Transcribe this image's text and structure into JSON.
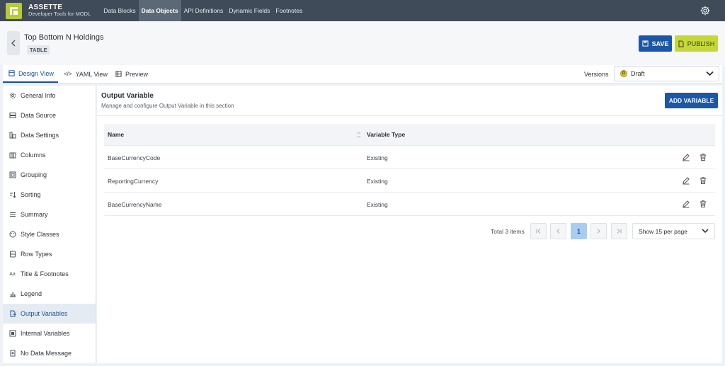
{
  "app": {
    "brand_name": "ASSETTE",
    "brand_sub": "Developer Tools for MODL",
    "nav": [
      "Data Blocks",
      "Data Objects",
      "API Definitions",
      "Dynamic Fields",
      "Footnotes"
    ],
    "active_nav": "Data Objects",
    "accent": "#1c56a6",
    "publish_color": "#c4d83a",
    "topbar_color": "#3f4b58"
  },
  "header": {
    "title": "Top Bottom N Holdings",
    "badge": "TABLE",
    "save_label": "SAVE",
    "publish_label": "PUBLISH"
  },
  "view_tabs": {
    "design": "Design View",
    "yaml": "YAML View",
    "preview": "Preview"
  },
  "versions": {
    "label": "Versions",
    "selected": "Draft",
    "badge_letter": "D"
  },
  "sidebar": {
    "items": [
      {
        "label": "General Info",
        "icon": "gear-icon"
      },
      {
        "label": "Data Source",
        "icon": "database-icon"
      },
      {
        "label": "Data Settings",
        "icon": "data-settings-icon"
      },
      {
        "label": "Columns",
        "icon": "columns-icon"
      },
      {
        "label": "Grouping",
        "icon": "grouping-icon"
      },
      {
        "label": "Sorting",
        "icon": "sort-icon"
      },
      {
        "label": "Summary",
        "icon": "summary-icon"
      },
      {
        "label": "Style Classes",
        "icon": "palette-icon"
      },
      {
        "label": "Row Types",
        "icon": "row-types-icon"
      },
      {
        "label": "Title & Footnotes",
        "icon": "text-icon"
      },
      {
        "label": "Legend",
        "icon": "legend-icon"
      },
      {
        "label": "Output Variables",
        "icon": "output-variable-icon"
      },
      {
        "label": "Internal Variables",
        "icon": "internal-variable-icon"
      },
      {
        "label": "No Data Message",
        "icon": "message-icon"
      }
    ],
    "active": "Output Variables",
    "text_icon_glyph": "Aa"
  },
  "section": {
    "title": "Output Variable",
    "subtitle": "Manage and configure Output Variable in this section",
    "add_label": "ADD VARIABLE"
  },
  "table": {
    "columns": [
      "Name",
      "Variable Type"
    ],
    "rows": [
      {
        "name": "BaseCurrencyCode",
        "type": "Existing"
      },
      {
        "name": "ReportingCurrency",
        "type": "Existing"
      },
      {
        "name": "BaseCurrencyName",
        "type": "Existing"
      }
    ]
  },
  "pagination": {
    "total": "Total 3 items",
    "current_page": "1",
    "per_page": "Show 15 per page"
  }
}
